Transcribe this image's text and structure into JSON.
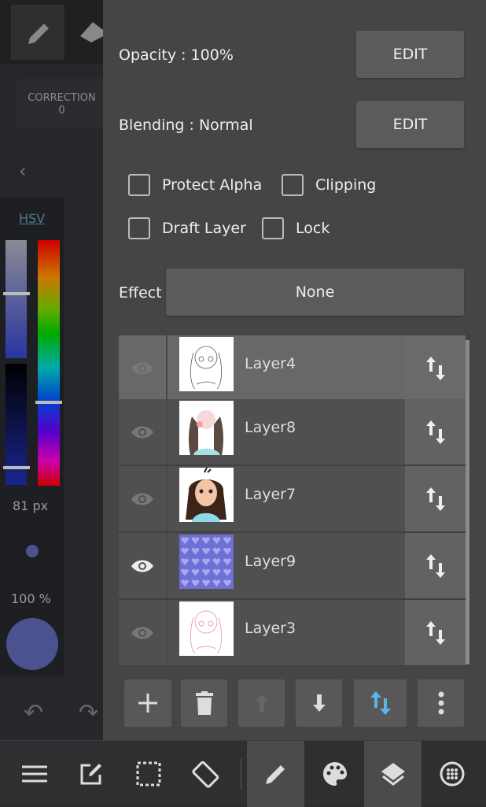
{
  "left_panel": {
    "correction_label": "CORRECTION",
    "correction_value": "0",
    "color_mode": "HSV",
    "brush_size": "81 px",
    "brush_opacity": "100 %",
    "brush_color": "#4a5290"
  },
  "layer_props": {
    "opacity": "Opacity : 100%",
    "blending": "Blending : Normal",
    "edit_label": "EDIT",
    "checkboxes": [
      {
        "label": "Protect Alpha",
        "checked": false
      },
      {
        "label": "Clipping",
        "checked": false
      },
      {
        "label": "Draft Layer",
        "checked": false
      },
      {
        "label": "Lock",
        "checked": false
      }
    ],
    "effect_label": "Effect",
    "effect_value": "None"
  },
  "layers": [
    {
      "name": "Layer4",
      "visible": false,
      "selected": true,
      "thumb": "sketch"
    },
    {
      "name": "Layer8",
      "visible": false,
      "selected": false,
      "thumb": "color"
    },
    {
      "name": "Layer7",
      "visible": false,
      "selected": false,
      "thumb": "girl"
    },
    {
      "name": "Layer9",
      "visible": true,
      "selected": false,
      "thumb": "hearts"
    },
    {
      "name": "Layer3",
      "visible": false,
      "selected": false,
      "thumb": "pink-sketch"
    }
  ],
  "layer_actions": [
    "add-layer",
    "delete-layer",
    "move-up",
    "move-down",
    "reorder",
    "more"
  ],
  "accent": "#5bb6e6",
  "bottom_toolbar": [
    "menu",
    "edit",
    "select",
    "rotate",
    "brush",
    "palette",
    "layers",
    "material"
  ]
}
